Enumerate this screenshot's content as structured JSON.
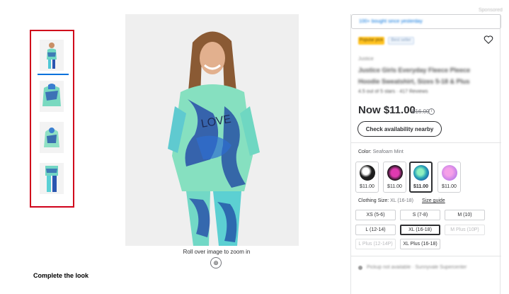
{
  "header": {
    "crumb": "Sponsored"
  },
  "sold_bar": {
    "text": "100+ bought since yesterday"
  },
  "badges": {
    "first": "Popular pick",
    "second": "Best seller"
  },
  "product": {
    "brand": "Justice",
    "title_line1": "Justice Girls Everyday Fleece Pleece",
    "title_line2": "Hoodie Sweatshirt, Sizes 5-18 & Plus",
    "rating_text": "4.5 out of 5 stars · 417 Reviews",
    "price_now": "Now $11.00",
    "price_was": "$16.00",
    "info_glyph": "i"
  },
  "actions": {
    "check_availability": "Check availability nearby"
  },
  "color": {
    "label": "Color:",
    "value": "Seafoam Mint",
    "swatches": [
      {
        "price": "$11.00",
        "color": "#1e1e1e",
        "accent": "#ffffff"
      },
      {
        "price": "$11.00",
        "color": "#b0157a",
        "accent": "#111111"
      },
      {
        "price": "$11.00",
        "color": "#2aa5b5",
        "accent": "#6fe0a8"
      },
      {
        "price": "$11.00",
        "color": "#c27fe8",
        "accent": "#f5a0e8"
      }
    ]
  },
  "size": {
    "label": "Clothing Size:",
    "value": "XL (16-18)",
    "guide": "Size guide",
    "options": [
      {
        "label": "XS (5-6)",
        "state": "normal"
      },
      {
        "label": "S (7-8)",
        "state": "normal"
      },
      {
        "label": "M (10)",
        "state": "normal"
      },
      {
        "label": "L (12-14)",
        "state": "normal"
      },
      {
        "label": "XL (16-18)",
        "state": "selected"
      },
      {
        "label": "M Plus (10P)",
        "state": "disabled"
      },
      {
        "label": "L Plus (12-14P)",
        "state": "disabled"
      },
      {
        "label": "XL Plus (16-18)",
        "state": "normal"
      }
    ]
  },
  "fulfillment": {
    "text": "Pickup not available · Sunnyvale Supercenter"
  },
  "gallery": {
    "zoom_hint": "Roll over image to zoom in",
    "zoom_glyph": "⊕",
    "selected_index": 1
  },
  "section": {
    "complete_the_look": "Complete the look"
  },
  "colors": {
    "accent": "#0071dc",
    "highlight_border": "#d0021b",
    "badge_yellow": "#ffc220"
  },
  "icons": [
    "heart-icon",
    "info-icon",
    "zoom-icon"
  ]
}
